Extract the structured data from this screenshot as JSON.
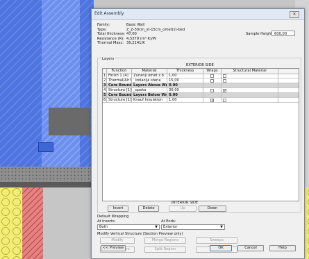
{
  "dialog": {
    "title": "Edit Assembly",
    "close": "✕"
  },
  "props": [
    {
      "label": "Family:",
      "value": "Basic Wall"
    },
    {
      "label": "Type:",
      "value": "Z_Z-30cm_st-15cm_omet(z)-bed"
    },
    {
      "label": "Total thickness:",
      "value": "47,00"
    },
    {
      "label": "Resistance (R):",
      "value": "4,5379 (m²·K)/W"
    },
    {
      "label": "Thermal Mass:",
      "value": "39,2141/K"
    }
  ],
  "sample_height": {
    "label": "Sample Height:",
    "value": "600,00"
  },
  "layers": {
    "caption": "Layers",
    "top_side": "EXTERIOR SIDE",
    "bottom_side": "INTERIOR SIDE",
    "columns": [
      "",
      "Function",
      "Material",
      "Thickness",
      "Wraps",
      "Structural Material"
    ],
    "rows": [
      {
        "num": "1",
        "fn": "Finish 1 [4]",
        "mat": "Zunanji omet z b",
        "th": "1,00",
        "wraps": false,
        "struct": false,
        "core": false
      },
      {
        "num": "2",
        "fn": "Thermal/Air Layer [",
        "mat": "_izolacija stena",
        "th": "15,00",
        "wraps": false,
        "struct": false,
        "core": false
      },
      {
        "num": "3",
        "fn": "Core Boundary",
        "mat": "Layers Above Wra",
        "th": "0.00",
        "wraps": null,
        "struct": null,
        "core": true
      },
      {
        "num": "4",
        "fn": "Structure [1]",
        "mat": "_opeka",
        "th": "30,00",
        "wraps": false,
        "struct": true,
        "core": false
      },
      {
        "num": "5",
        "fn": "Core Boundary",
        "mat": "Layers Below Wrap",
        "th": "0.00",
        "wraps": null,
        "struct": null,
        "core": true
      },
      {
        "num": "6",
        "fn": "Structure [1]",
        "mat": "Knauf Insulation",
        "th": "1,00",
        "wraps": true,
        "struct": false,
        "core": false
      }
    ]
  },
  "buttons": {
    "insert": "Insert",
    "delete": "Delete",
    "up": "Up",
    "down": "Down",
    "modify": "Modify",
    "merge": "Merge Regions",
    "sweeps": "Sweeps",
    "assign": "Assign Layers",
    "split": "Split Region",
    "reveals": "Reveals",
    "preview": "<< Preview",
    "ok": "OK",
    "cancel": "Cancel",
    "help": "Help"
  },
  "wrapping": {
    "title": "Default Wrapping",
    "inserts_label": "At Inserts:",
    "inserts_value": "Both",
    "ends_label": "At Ends:",
    "ends_value": "Exterior"
  },
  "vertical_title": "Modify Vertical Structure (Section Preview only)",
  "colors": {
    "accent": "#dfe8f3",
    "core_row": "#d5d5d5",
    "bim_blue": "#4d74e0",
    "bim_red": "#e58383",
    "bim_yellow": "#f3ec77"
  }
}
